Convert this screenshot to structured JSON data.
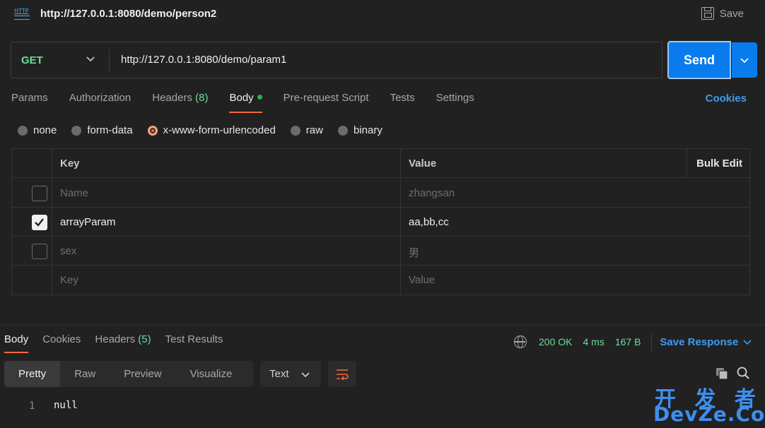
{
  "titlebar": {
    "title": "http://127.0.0.1:8080/demo/person2",
    "save_label": "Save",
    "icon_text": "HTTP"
  },
  "request": {
    "method": "GET",
    "url": "http://127.0.0.1:8080/demo/param1",
    "send_label": "Send"
  },
  "tabs": [
    {
      "label": "Params"
    },
    {
      "label": "Authorization"
    },
    {
      "label": "Headers",
      "count": "(8)"
    },
    {
      "label": "Body",
      "active": true
    },
    {
      "label": "Pre-request Script"
    },
    {
      "label": "Tests"
    },
    {
      "label": "Settings"
    }
  ],
  "cookies_label": "Cookies",
  "body_modes": [
    "none",
    "form-data",
    "x-www-form-urlencoded",
    "raw",
    "binary"
  ],
  "body_mode_selected": "x-www-form-urlencoded",
  "table": {
    "headers": {
      "key": "Key",
      "value": "Value",
      "bulk_edit": "Bulk Edit"
    },
    "rows": [
      {
        "key": "Name",
        "value": "zhangsan",
        "checked": false
      },
      {
        "key": "arrayParam",
        "value": "aa,bb,cc",
        "checked": true
      },
      {
        "key": "sex",
        "value": "男",
        "checked": false
      },
      {
        "key": "Key",
        "value": "Value",
        "placeholder": true
      }
    ]
  },
  "response": {
    "tabs": [
      {
        "label": "Body",
        "active": true
      },
      {
        "label": "Cookies"
      },
      {
        "label": "Headers",
        "count": "(5)"
      },
      {
        "label": "Test Results"
      }
    ],
    "status": "200 OK",
    "time": "4 ms",
    "size": "167 B",
    "save_response_label": "Save Response",
    "formats": [
      "Pretty",
      "Raw",
      "Preview",
      "Visualize"
    ],
    "format_selected": "Pretty",
    "text_type": "Text",
    "lines": [
      {
        "no": "1",
        "code": "null"
      }
    ]
  },
  "watermark": {
    "top": "开 发 者",
    "bottom": "DevZe.CoM"
  },
  "colors": {
    "accent_orange": "#f26b3a",
    "send_blue": "#097bed",
    "method_green": "#6bdd9a",
    "link_blue": "#3d9bf0"
  }
}
